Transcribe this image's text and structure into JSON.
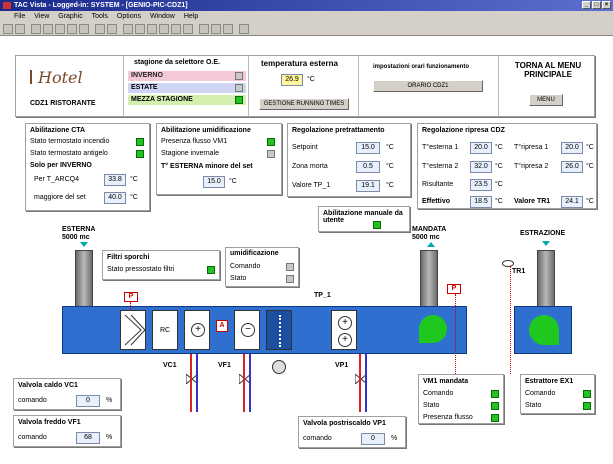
{
  "window": {
    "title": "TAC Vista - Logged-in: SYSTEM - [GENIO-PIC-CDZ1]"
  },
  "menu": [
    "File",
    "View",
    "Graphic",
    "Tools",
    "Options",
    "Window",
    "Help"
  ],
  "header": {
    "logo_text": "Hotel",
    "zone": "CDZ1 RISTORANTE",
    "season_title": "stagione da selettore O.E.",
    "season_winter": "INVERNO",
    "season_summer": "ESTATE",
    "season_mid": "MEZZA STAGIONE",
    "temp_title": "temperatura esterna",
    "temp_value": "26.9",
    "temp_unit": "°C",
    "running_btn": "GESTIONE RUNNING TIMES",
    "schedule_title": "impostazioni orari funzionamento",
    "schedule_btn": "ORARIO CDZ1",
    "back_title": "TORNA AL MENU PRINCIPALE",
    "menu_btn": "MENU"
  },
  "cta": {
    "title": "Abilitazione CTA",
    "fire": "Stato termostato incendio",
    "frost": "Stato termostato antigelo",
    "winter_only": "Solo per INVERNO",
    "arcq4_label": "Per T_ARCQ4",
    "arcq4_value": "33.8",
    "unit": "°C",
    "over_label": "maggiore del set",
    "over_value": "40.0"
  },
  "humid": {
    "title": "Abilitazione umidificazione",
    "flow": "Presenza flusso VM1",
    "winter": "Stagione invernale",
    "text_t": "T° ESTERNA minore del set",
    "set_value": "15.0",
    "unit": "°C"
  },
  "pre": {
    "title": "Regolazione pretrattamento",
    "setpoint_label": "Setpoint",
    "setpoint": "15.0",
    "dead_label": "Zona morta",
    "dead": "0.5",
    "tp1_label": "Valore TP_1",
    "tp1": "19.1",
    "unit": "°C"
  },
  "recovery": {
    "title": "Regolazione ripresa CDZ",
    "text1_label": "T°esterna 1",
    "text1": "20.0",
    "text2_label": "T°esterna 2",
    "text2": "32.0",
    "tr1_label": "T°ripresa 1",
    "tr1": "20.0",
    "tr2_label": "T°ripresa 2",
    "tr2": "26.0",
    "result_label": "Risultante",
    "result": "23.5",
    "eff_label": "Effettivo",
    "eff": "18.5",
    "valtr1_label": "Valore TR1",
    "valtr1": "24.1",
    "unit": "°C"
  },
  "manual": {
    "title": "Abilitazione manuale da utente"
  },
  "plant": {
    "esterna": "ESTERNA\n5000 mc",
    "mandata": "MANDATA\n5000 mc",
    "estrazione": "ESTRAZIONE",
    "tp1": "TP_1",
    "tr1": "TR1",
    "rc": "RC",
    "vc1": "VC1",
    "vf1": "VF1",
    "vp1": "VP1",
    "p": "P",
    "a": "A"
  },
  "filters": {
    "title": "Filtri sporchi",
    "status": "Stato pressostato filtri"
  },
  "umid": {
    "title": "umidificazione",
    "cmd": "Comando",
    "state": "Stato"
  },
  "vc1": {
    "title": "Valvola caldo VC1",
    "cmd": "comando",
    "value": "0",
    "unit": "%"
  },
  "vf1": {
    "title": "Valvola freddo VF1",
    "cmd": "comando",
    "value": "68",
    "unit": "%"
  },
  "vp1": {
    "title": "Valvola postriscaldo VP1",
    "cmd": "comando",
    "value": "0",
    "unit": "%"
  },
  "vm1": {
    "title": "VM1 mandata",
    "cmd": "Comando",
    "state": "Stato",
    "flow": "Presenza flusso"
  },
  "ex1": {
    "title": "Estrattore EX1",
    "cmd": "Comando",
    "state": "Stato"
  }
}
